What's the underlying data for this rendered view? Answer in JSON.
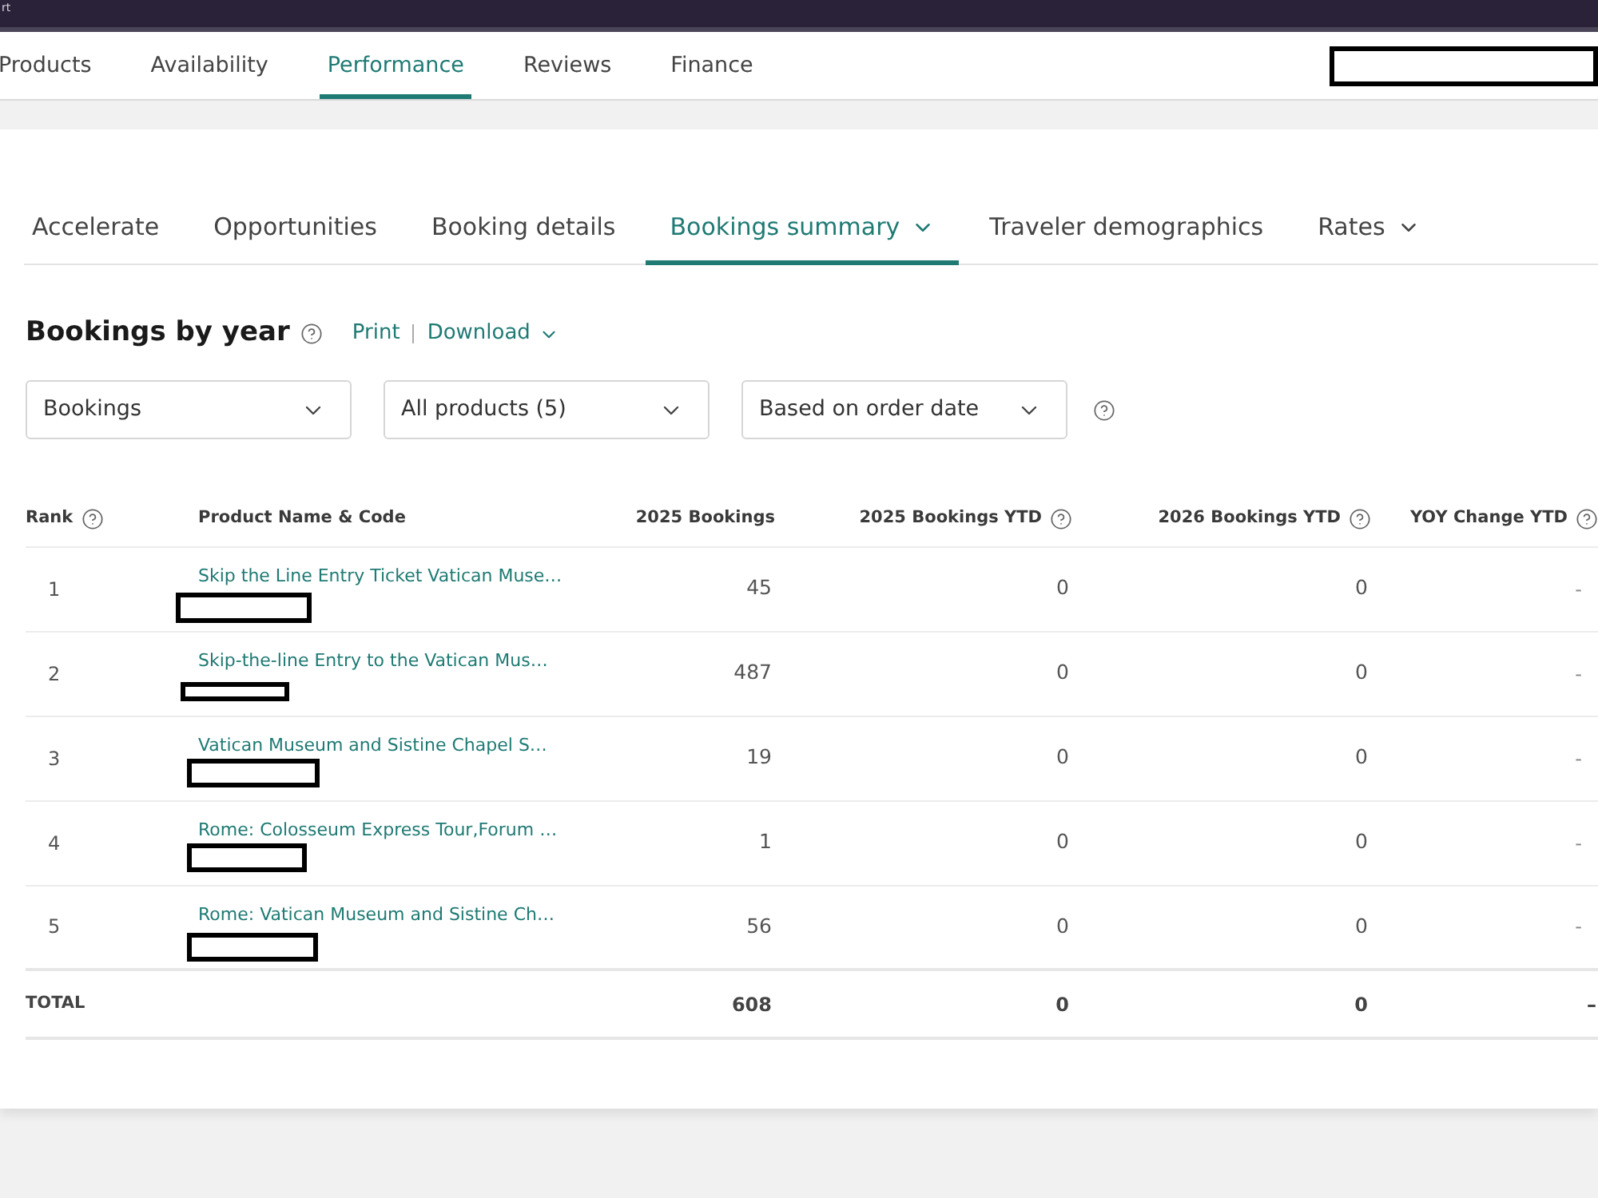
{
  "browser_bar": {
    "title": "rt"
  },
  "top_nav": {
    "tabs": [
      {
        "label": "Products",
        "selected": false
      },
      {
        "label": "Availability",
        "selected": false
      },
      {
        "label": "Performance",
        "selected": true
      },
      {
        "label": "Reviews",
        "selected": false
      },
      {
        "label": "Finance",
        "selected": false
      }
    ],
    "redacted_box": true
  },
  "sub_tabs": [
    {
      "label": "Accelerate",
      "selected": false,
      "has_menu": false
    },
    {
      "label": "Opportunities",
      "selected": false,
      "has_menu": false
    },
    {
      "label": "Booking details",
      "selected": false,
      "has_menu": false
    },
    {
      "label": "Bookings summary",
      "selected": true,
      "has_menu": true
    },
    {
      "label": "Traveler demographics",
      "selected": false,
      "has_menu": false
    },
    {
      "label": "Rates",
      "selected": false,
      "has_menu": true
    }
  ],
  "report": {
    "title": "Bookings by year",
    "help": true,
    "actions": [
      {
        "label": "Print",
        "has_menu": false
      },
      {
        "label": "Download",
        "has_menu": true
      }
    ]
  },
  "filters": {
    "dropdowns": [
      {
        "value": "Bookings"
      },
      {
        "value": "All products (5)"
      },
      {
        "value": "Based on order date"
      }
    ],
    "help": true
  },
  "table": {
    "columns": [
      {
        "label": "Rank",
        "help": true
      },
      {
        "label": "Product Name & Code",
        "help": false
      },
      {
        "label": "2025 Bookings",
        "help": false
      },
      {
        "label": "2025 Bookings YTD",
        "help": true
      },
      {
        "label": "2026 Bookings YTD",
        "help": true
      },
      {
        "label": "YOY Change YTD",
        "help": true
      }
    ],
    "rows": [
      {
        "rank": "1",
        "product": "Skip the Line Entry Ticket Vatican Muse…",
        "code_redacted": true,
        "bookings_2025": "45",
        "bookings_2025_ytd": "0",
        "bookings_2026_ytd": "0",
        "yoy_change_ytd": "-"
      },
      {
        "rank": "2",
        "product": "Skip-the-line Entry to the Vatican Mus…",
        "code_redacted": true,
        "bookings_2025": "487",
        "bookings_2025_ytd": "0",
        "bookings_2026_ytd": "0",
        "yoy_change_ytd": "-"
      },
      {
        "rank": "3",
        "product": "Vatican Museum and Sistine Chapel S…",
        "code_redacted": true,
        "bookings_2025": "19",
        "bookings_2025_ytd": "0",
        "bookings_2026_ytd": "0",
        "yoy_change_ytd": "-"
      },
      {
        "rank": "4",
        "product": "Rome: Colosseum Express Tour,Forum …",
        "code_redacted": true,
        "bookings_2025": "1",
        "bookings_2025_ytd": "0",
        "bookings_2026_ytd": "0",
        "yoy_change_ytd": "-"
      },
      {
        "rank": "5",
        "product": "Rome: Vatican Museum and Sistine Ch…",
        "code_redacted": true,
        "bookings_2025": "56",
        "bookings_2025_ytd": "0",
        "bookings_2026_ytd": "0",
        "yoy_change_ytd": "-"
      }
    ],
    "total": {
      "label": "TOTAL",
      "bookings_2025": "608",
      "bookings_2025_ytd": "0",
      "bookings_2026_ytd": "0",
      "yoy_change_ytd": "–"
    }
  }
}
